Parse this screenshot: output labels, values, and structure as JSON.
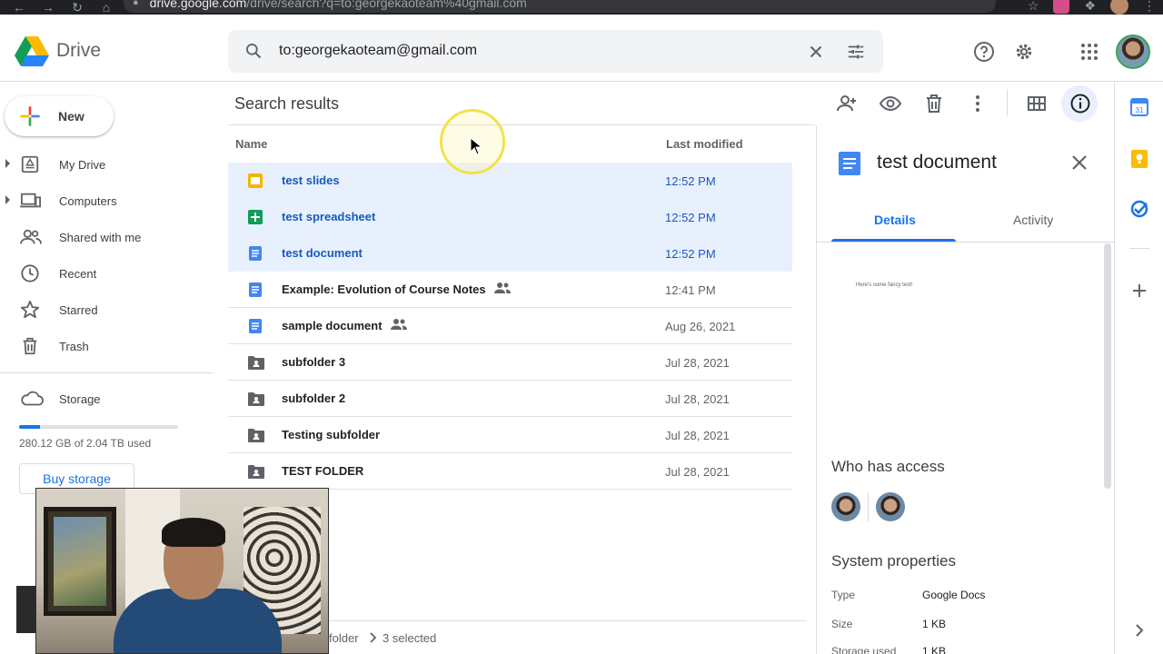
{
  "browser": {
    "url_host": "drive.google.com",
    "url_rest": "/drive/search?q=to:georgekaoteam%40gmail.com"
  },
  "app": {
    "brand": "Drive"
  },
  "search": {
    "query": "to:georgekaoteam@gmail.com"
  },
  "sidebar": {
    "new_label": "New",
    "items": [
      {
        "label": "My Drive",
        "icon": "my-drive-icon",
        "expandable": true
      },
      {
        "label": "Computers",
        "icon": "computers-icon",
        "expandable": true
      },
      {
        "label": "Shared with me",
        "icon": "shared-with-me-icon",
        "expandable": false
      },
      {
        "label": "Recent",
        "icon": "clock-icon",
        "expandable": false
      },
      {
        "label": "Starred",
        "icon": "star-icon",
        "expandable": false
      },
      {
        "label": "Trash",
        "icon": "trash-icon",
        "expandable": false
      }
    ],
    "storage_label": "Storage",
    "storage_used_text": "280.12 GB of 2.04 TB used",
    "storage_fraction": 0.134,
    "buy_storage_label": "Buy storage"
  },
  "main": {
    "title": "Search results",
    "col_name": "Name",
    "col_modified": "Last modified",
    "rows": [
      {
        "name": "test slides",
        "type": "slides",
        "modified": "12:52 PM",
        "selected": true,
        "shared": false
      },
      {
        "name": "test spreadsheet",
        "type": "sheets",
        "modified": "12:52 PM",
        "selected": true,
        "shared": false
      },
      {
        "name": "test document",
        "type": "docs",
        "modified": "12:52 PM",
        "selected": true,
        "shared": false
      },
      {
        "name": "Example: Evolution of Course Notes",
        "type": "docs",
        "modified": "12:41 PM",
        "selected": false,
        "shared": true
      },
      {
        "name": "sample document",
        "type": "docs",
        "modified": "Aug 26, 2021",
        "selected": false,
        "shared": true
      },
      {
        "name": "subfolder 3",
        "type": "shared-folder",
        "modified": "Jul 28, 2021",
        "selected": false,
        "shared": false
      },
      {
        "name": "subfolder 2",
        "type": "shared-folder",
        "modified": "Jul 28, 2021",
        "selected": false,
        "shared": false
      },
      {
        "name": "Testing subfolder",
        "type": "shared-folder",
        "modified": "Jul 28, 2021",
        "selected": false,
        "shared": false
      },
      {
        "name": "TEST FOLDER",
        "type": "shared-folder",
        "modified": "Jul 28, 2021",
        "selected": false,
        "shared": false
      }
    ],
    "footer_crumb": "folder",
    "footer_selected": "3 selected"
  },
  "details": {
    "title": "test document",
    "tab_details": "Details",
    "tab_activity": "Activity",
    "preview_text": "Here's some fancy text!",
    "who_has_access": "Who has access",
    "system_properties": "System properties",
    "props": [
      {
        "label": "Type",
        "value": "Google Docs"
      },
      {
        "label": "Size",
        "value": "1 KB"
      },
      {
        "label": "Storage used",
        "value": "1 KB"
      }
    ]
  },
  "colors": {
    "accent": "#1a73e8",
    "selected_bg": "#e8f0fe",
    "slides": "#f4b400",
    "sheets": "#0f9d58",
    "docs": "#4285f4",
    "folder": "#5f6368"
  }
}
